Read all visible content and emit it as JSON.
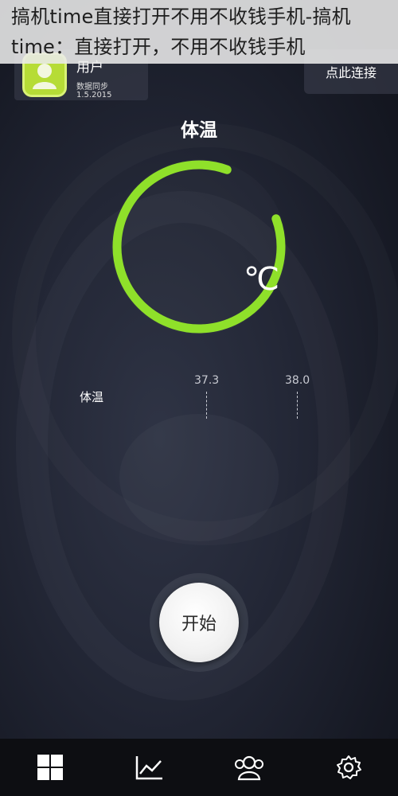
{
  "status_bar": {
    "left_text": "",
    "right_text": ""
  },
  "overlay": {
    "text": "搞机time直接打开不用不收钱手机-搞机time：直接打开，不用不收钱手机"
  },
  "profile": {
    "username": "用户",
    "sync_label": "数据同步",
    "sync_date": "1.5.2015"
  },
  "connect_button": {
    "label": "点此连接"
  },
  "page_title": "体温",
  "gauge": {
    "unit": "℃",
    "arc_color": "#8fe02a"
  },
  "scale": {
    "label": "体温",
    "ticks": [
      "37.3",
      "38.0"
    ]
  },
  "start_button": {
    "label": "开始"
  },
  "tabbar": {
    "tabs": [
      {
        "icon": "dashboard-grid-icon",
        "active": true
      },
      {
        "icon": "chart-line-icon",
        "active": false
      },
      {
        "icon": "users-icon",
        "active": false
      },
      {
        "icon": "gear-icon",
        "active": false
      }
    ]
  }
}
